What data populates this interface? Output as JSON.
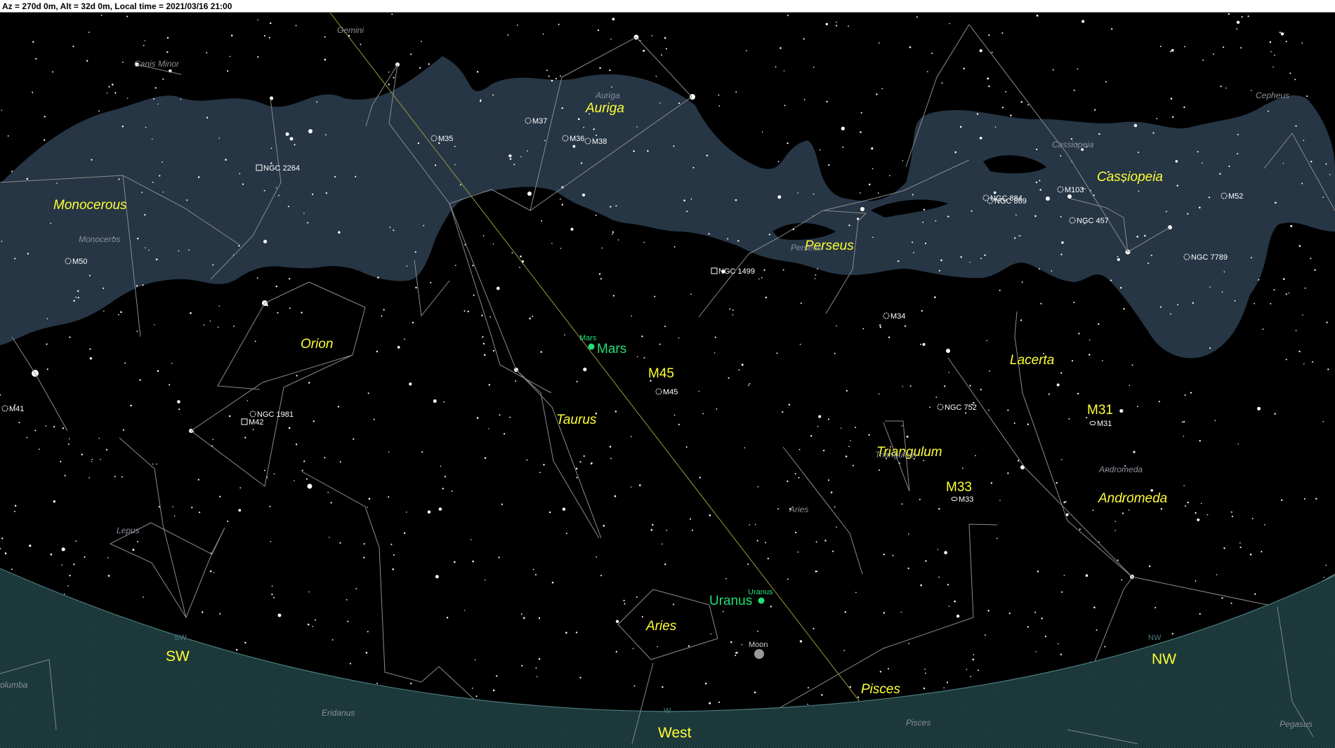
{
  "status_bar": {
    "text": "Az = 270d 0m, Alt = 32d 0m, Local time = 2021/03/16 21:00"
  },
  "colors": {
    "sky": "#000000",
    "milky_way": "#263645",
    "horizon": "#1e3a3c",
    "constellation_label": "#ffff33",
    "constellation_faint": "#8a8f99",
    "planet": "#22dd77",
    "messier_label": "#ffffff",
    "ecliptic": "#9a9a3a",
    "lines": "#8c8c8c"
  },
  "constellations": [
    {
      "name": "Monocerous"
    },
    {
      "name": "Auriga"
    },
    {
      "name": "Cassiopeia"
    },
    {
      "name": "Perseus"
    },
    {
      "name": "Orion"
    },
    {
      "name": "Taurus"
    },
    {
      "name": "Lacerta"
    },
    {
      "name": "Triangulum"
    },
    {
      "name": "Andromeda"
    },
    {
      "name": "Aries"
    },
    {
      "name": "Pisces"
    }
  ],
  "faint_labels": [
    {
      "name": "Gemini"
    },
    {
      "name": "Canis Minor"
    },
    {
      "name": "Monoceros"
    },
    {
      "name": "Auriga"
    },
    {
      "name": "Cepheus"
    },
    {
      "name": "Cassiopeia"
    },
    {
      "name": "Perseus"
    },
    {
      "name": "Lepus"
    },
    {
      "name": "Aries"
    },
    {
      "name": "Andromeda"
    },
    {
      "name": "Triangulum"
    },
    {
      "name": "Eridanus"
    },
    {
      "name": "Pisces"
    },
    {
      "name": "Pegasus"
    },
    {
      "name": "olumba"
    }
  ],
  "deep_sky": [
    {
      "name": "M37"
    },
    {
      "name": "M36"
    },
    {
      "name": "M38"
    },
    {
      "name": "M35"
    },
    {
      "name": "NGC 2264"
    },
    {
      "name": "M50"
    },
    {
      "name": "M41"
    },
    {
      "name": "NGC 1981"
    },
    {
      "name": "M42"
    },
    {
      "name": "NGC 1499"
    },
    {
      "name": "M34"
    },
    {
      "name": "M45"
    },
    {
      "name": "NGC 752"
    },
    {
      "name": "M33"
    },
    {
      "name": "M31"
    },
    {
      "name": "NGC 884"
    },
    {
      "name": "NGC 869"
    },
    {
      "name": "M103"
    },
    {
      "name": "NGC 457"
    },
    {
      "name": "M52"
    },
    {
      "name": "NGC 7789"
    }
  ],
  "messier_big": [
    {
      "name": "M45"
    },
    {
      "name": "M31"
    },
    {
      "name": "M33"
    }
  ],
  "planets": [
    {
      "name": "Mars",
      "small": "Mars"
    },
    {
      "name": "Uranus",
      "small": "Uranus"
    },
    {
      "name": "Moon",
      "small": "Moon"
    }
  ],
  "directions": [
    {
      "name": "SW",
      "small": "SW"
    },
    {
      "name": "West",
      "small": "W"
    },
    {
      "name": "NW",
      "small": "NW"
    }
  ]
}
